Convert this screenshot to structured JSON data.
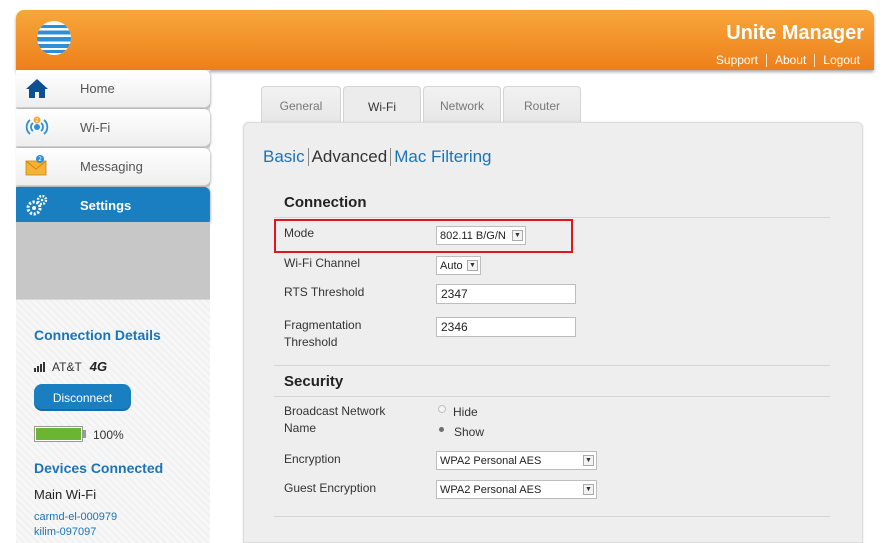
{
  "header": {
    "app_title": "Unite Manager",
    "links": {
      "support": "Support",
      "about": "About",
      "logout": "Logout"
    },
    "logo_icon": "att-globe-icon"
  },
  "sidebar": {
    "items": [
      {
        "label": "Home",
        "icon": "home-icon",
        "active": false
      },
      {
        "label": "Wi-Fi",
        "icon": "wifi-icon",
        "active": false
      },
      {
        "label": "Messaging",
        "icon": "envelope-icon",
        "active": false
      },
      {
        "label": "Settings",
        "icon": "gears-icon",
        "active": true
      }
    ],
    "connection": {
      "title": "Connection Details",
      "carrier": "AT&T",
      "network_badge": "4G",
      "disconnect_label": "Disconnect",
      "battery_percent_text": "100%",
      "battery_level": 1.0
    },
    "devices": {
      "title": "Devices Connected",
      "network_name": "Main Wi-Fi",
      "list": [
        "carmd-el-000979",
        "kilim-097097"
      ]
    }
  },
  "tabs": [
    {
      "label": "General",
      "active": false
    },
    {
      "label": "Wi-Fi",
      "active": true
    },
    {
      "label": "Network",
      "active": false
    },
    {
      "label": "Router",
      "active": false
    }
  ],
  "subnav": {
    "basic": "Basic",
    "advanced": "Advanced",
    "mac_filtering": "Mac Filtering"
  },
  "connection_section": {
    "title": "Connection",
    "mode": {
      "label": "Mode",
      "value": "802.11 B/G/N"
    },
    "wifi_channel": {
      "label": "Wi-Fi Channel",
      "value": "Auto"
    },
    "rts_threshold": {
      "label": "RTS Threshold",
      "value": "2347"
    },
    "fragmentation": {
      "label": "Fragmentation Threshold",
      "value": "2346"
    }
  },
  "security_section": {
    "title": "Security",
    "broadcast": {
      "label": "Broadcast Network Name",
      "options": [
        "Hide",
        "Show"
      ],
      "selected": "Show"
    },
    "encryption": {
      "label": "Encryption",
      "value": "WPA2 Personal AES"
    },
    "guest_encryption": {
      "label": "Guest Encryption",
      "value": "WPA2 Personal AES"
    }
  },
  "colors": {
    "header_orange": "#f29a2e",
    "accent_blue": "#1a7fc1",
    "link_blue": "#1a74b8",
    "highlight_red": "#e3141b",
    "battery_green": "#6ab633"
  }
}
